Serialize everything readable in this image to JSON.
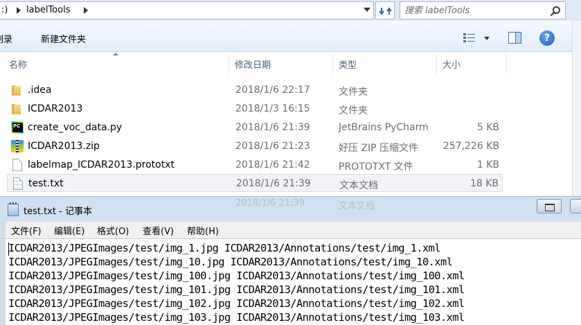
{
  "explorer": {
    "address": {
      "crumb_prefix": ":)",
      "crumb_folder": "labelTools"
    },
    "search": {
      "placeholder": "搜索 labelTools"
    },
    "toolbar": {
      "burn_label": "刻录",
      "new_folder_label": "新建文件夹"
    },
    "columns": {
      "name": "名称",
      "date": "修改日期",
      "type": "类型",
      "size": "大小"
    },
    "files": [
      {
        "name": ".idea",
        "date": "2018/1/6 22:17",
        "type": "文件夹",
        "size": "",
        "icon": "folder-icon"
      },
      {
        "name": "ICDAR2013",
        "date": "2018/1/3 16:15",
        "type": "文件夹",
        "size": "",
        "icon": "folder-icon"
      },
      {
        "name": "create_voc_data.py",
        "date": "2018/1/6 21:39",
        "type": "JetBrains PyCharm",
        "size": "5 KB",
        "icon": "pycharm-file-icon"
      },
      {
        "name": "ICDAR2013.zip",
        "date": "2018/1/6 21:23",
        "type": "好压 ZIP 压缩文件",
        "size": "257,226 KB",
        "icon": "zip-archive-icon"
      },
      {
        "name": "labelmap_ICDAR2013.prototxt",
        "date": "2018/1/6 21:42",
        "type": "PROTOTXT 文件",
        "size": "1 KB",
        "icon": "document-icon"
      },
      {
        "name": "test.txt",
        "date": "2018/1/6 21:39",
        "type": "文本文档",
        "size": "18 KB",
        "icon": "text-document-icon"
      }
    ]
  },
  "notepad": {
    "title": "test.txt - 记事本",
    "menu": [
      "文件(F)",
      "编辑(E)",
      "格式(O)",
      "查看(V)",
      "帮助(H)"
    ],
    "lines": [
      "ICDAR2013/JPEGImages/test/img_1.jpg ICDAR2013/Annotations/test/img_1.xml",
      "ICDAR2013/JPEGImages/test/img_10.jpg ICDAR2013/Annotations/test/img_10.xml",
      "ICDAR2013/JPEGImages/test/img_100.jpg ICDAR2013/Annotations/test/img_100.xml",
      "ICDAR2013/JPEGImages/test/img_101.jpg ICDAR2013/Annotations/test/img_101.xml",
      "ICDAR2013/JPEGImages/test/img_102.jpg ICDAR2013/Annotations/test/img_102.xml",
      "ICDAR2013/JPEGImages/test/img_103.jpg ICDAR2013/Annotations/test/img_103.xml"
    ]
  },
  "colors": {
    "window_frame": "#cddef0",
    "header_text": "#4c607a",
    "help_blue": "#1f5fb5"
  }
}
